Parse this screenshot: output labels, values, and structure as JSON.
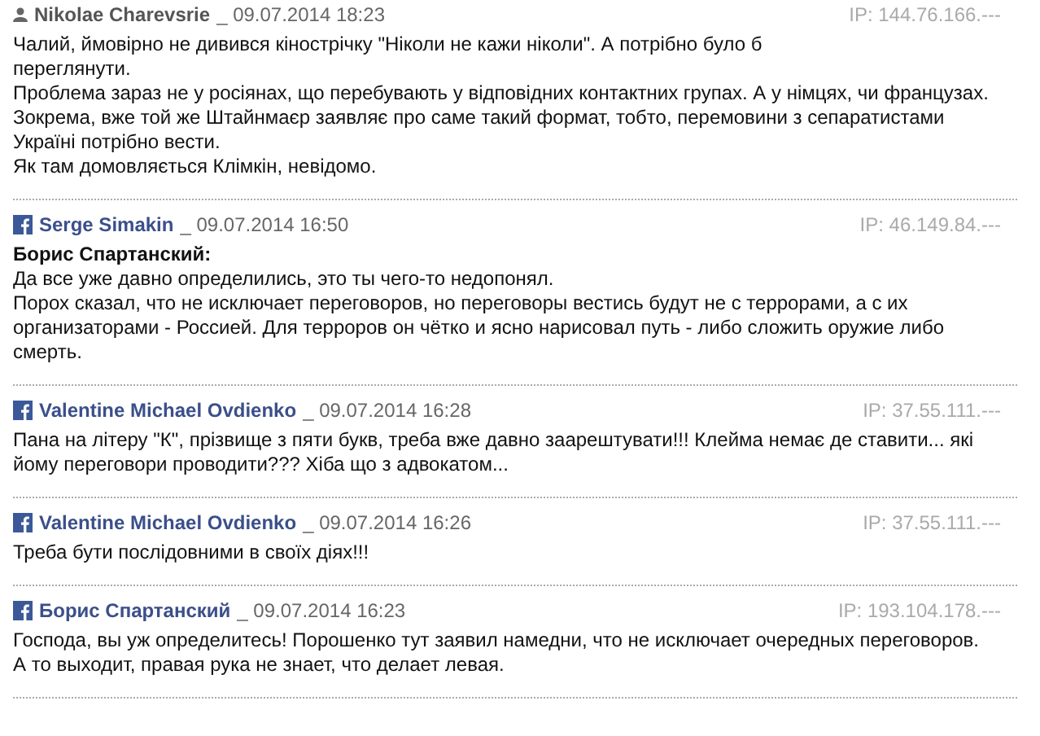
{
  "comments": [
    {
      "kind": "site",
      "author": "Nikolae Charevsrie",
      "date": "_ 09.07.2014 18:23",
      "ip": "IP: 144.76.166.---",
      "lines": [
        "Чалий, ймовірно не дивився кінострічку \"Ніколи не кажи ніколи\". А потрібно було б",
        "переглянути.",
        "Проблема зараз не у росіянах, що перебувають у відповідних контактних групах. А у німцях, чи французах.",
        "Зокрема, вже той же Штайнмаєр заявляє про саме такий формат, тобто, перемовини з сепаратистами",
        "Україні потрібно вести.",
        "Як там домовляється Клімкін, невідомо."
      ]
    },
    {
      "kind": "facebook",
      "author": "Serge Simakin",
      "date": "_ 09.07.2014 16:50",
      "ip": "IP: 46.149.84.---",
      "quote_author": "Борис Спартанский:",
      "lines": [
        "Да все уже давно определились, это ты чего-то недопонял.",
        "Порох сказал, что не исключает переговоров, но переговоры вестись будут не с террорами, а с их",
        "организаторами - Россией. Для терроров он чётко и ясно нарисовал путь - либо сложить оружие либо",
        "смерть."
      ]
    },
    {
      "kind": "facebook",
      "author": "Valentine Michael Ovdienko",
      "date": "_ 09.07.2014 16:28",
      "ip": "IP: 37.55.111.---",
      "lines": [
        "Пана на літеру \"К\", прізвище з пяти букв, треба вже давно заарештувати!!! Клейма немає де ставити... які",
        "йому переговори проводити??? Хіба що з адвокатом..."
      ]
    },
    {
      "kind": "facebook",
      "author": "Valentine Michael Ovdienko",
      "date": "_ 09.07.2014 16:26",
      "ip": "IP: 37.55.111.---",
      "lines": [
        "Треба бути послідовними в своїх діях!!!"
      ]
    },
    {
      "kind": "facebook",
      "author": "Борис Спартанский",
      "date": "_ 09.07.2014 16:23",
      "ip": "IP: 193.104.178.---",
      "lines": [
        "Господа, вы уж определитесь! Порошенко тут заявил намедни, что не исключает очередных переговоров.",
        "А то выходит, правая рука не знает, что делает левая."
      ]
    }
  ]
}
